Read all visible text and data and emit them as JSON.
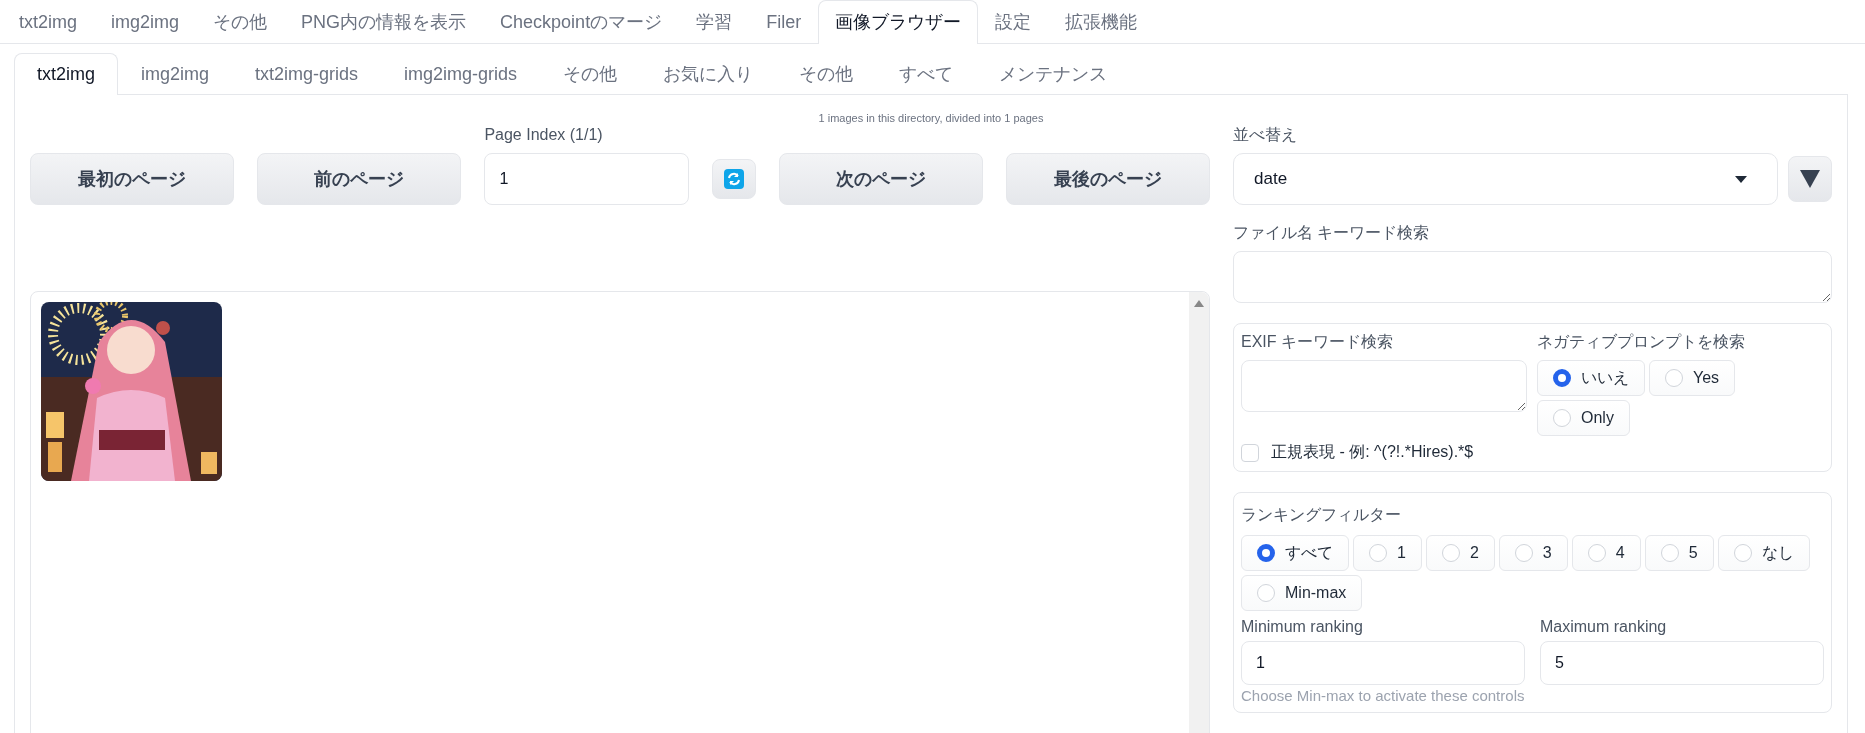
{
  "main_tabs": [
    {
      "label": "txt2img",
      "selected": false
    },
    {
      "label": "img2img",
      "selected": false
    },
    {
      "label": "その他",
      "selected": false
    },
    {
      "label": "PNG内の情報を表示",
      "selected": false
    },
    {
      "label": "Checkpointのマージ",
      "selected": false
    },
    {
      "label": "学習",
      "selected": false
    },
    {
      "label": "Filer",
      "selected": false
    },
    {
      "label": "画像ブラウザー",
      "selected": true
    },
    {
      "label": "設定",
      "selected": false
    },
    {
      "label": "拡張機能",
      "selected": false
    }
  ],
  "sub_tabs": [
    {
      "label": "txt2img",
      "selected": true
    },
    {
      "label": "img2img",
      "selected": false
    },
    {
      "label": "txt2img-grids",
      "selected": false
    },
    {
      "label": "img2img-grids",
      "selected": false
    },
    {
      "label": "その他",
      "selected": false
    },
    {
      "label": "お気に入り",
      "selected": false
    },
    {
      "label": "その他",
      "selected": false
    },
    {
      "label": "すべて",
      "selected": false
    },
    {
      "label": "メンテナンス",
      "selected": false
    }
  ],
  "info": "1 images in this directory, divided into 1 pages",
  "pager": {
    "first": "最初のページ",
    "prev": "前のページ",
    "page_index_label": "Page Index (1/1)",
    "page_index_value": "1",
    "next": "次のページ",
    "last": "最後のページ"
  },
  "sort": {
    "label": "並べ替え",
    "value": "date"
  },
  "filename_search": {
    "label": "ファイル名 キーワード検索"
  },
  "exif": {
    "label": "EXIF キーワード検索",
    "negative": {
      "label": "ネガティブプロンプトを検索",
      "options": [
        {
          "label": "いいえ",
          "selected": true
        },
        {
          "label": "Yes",
          "selected": false
        },
        {
          "label": "Only",
          "selected": false
        }
      ]
    },
    "regex": {
      "label": "正規表現 - 例: ^(?!.*Hires).*$",
      "checked": false
    }
  },
  "ranking": {
    "label": "ランキングフィルター",
    "options": [
      {
        "label": "すべて",
        "selected": true
      },
      {
        "label": "1",
        "selected": false
      },
      {
        "label": "2",
        "selected": false
      },
      {
        "label": "3",
        "selected": false
      },
      {
        "label": "4",
        "selected": false
      },
      {
        "label": "5",
        "selected": false
      },
      {
        "label": "なし",
        "selected": false
      },
      {
        "label": "Min-max",
        "selected": false
      }
    ],
    "min": {
      "label": "Minimum ranking",
      "value": "1"
    },
    "max": {
      "label": "Maximum ranking",
      "value": "5"
    },
    "hint": "Choose Min-max to activate these controls"
  }
}
